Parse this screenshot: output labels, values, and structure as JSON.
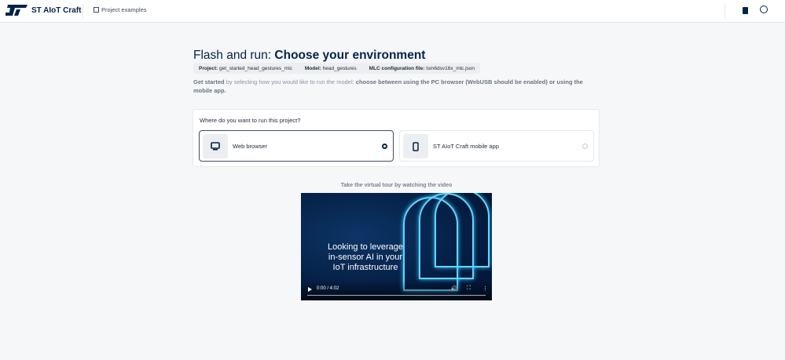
{
  "header": {
    "brand": "ST AIoT Craft",
    "nav_project_examples": "Project examples"
  },
  "page": {
    "title_prefix": "Flash and run:",
    "title_main": "Choose your environment",
    "meta": [
      {
        "label": "Project:",
        "value": "get_started_head_gestures_mlc"
      },
      {
        "label": "Model:",
        "value": "head_gestures"
      },
      {
        "label": "MLC configuration file:",
        "value": "lsm6dsv16x_mlc.json"
      }
    ],
    "intro_bold1": "Get started",
    "intro_text": " by selecting how you would like to run the model: ",
    "intro_bold2": "choose between using the PC browser (WebUSB should be enabled) or using the mobile app."
  },
  "env": {
    "question": "Where do you want to run this project?",
    "options": [
      {
        "label": "Web browser",
        "selected": true,
        "icon": "monitor-icon"
      },
      {
        "label": "ST AIoT Craft mobile app",
        "selected": false,
        "icon": "smartphone-icon"
      }
    ]
  },
  "video": {
    "caption": "Take the virtual tour by watching the video",
    "overlay_text": "Looking to leverage in-sensor AI in your IoT infrastructure",
    "time": "0:00 / 4:02",
    "progress": 0
  }
}
